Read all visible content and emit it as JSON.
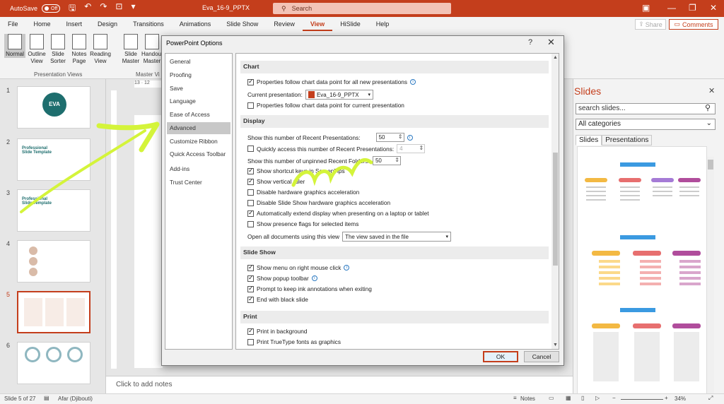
{
  "titlebar": {
    "autosave_label": "AutoSave",
    "autosave_state": "Off",
    "doc_title": "Eva_16-9_PPTX",
    "search_placeholder": "Search"
  },
  "menu": [
    "File",
    "Home",
    "Insert",
    "Design",
    "Transitions",
    "Animations",
    "Slide Show",
    "Review",
    "View",
    "HiSlide",
    "Help"
  ],
  "menu_active": "View",
  "share_label": "Share",
  "comments_label": "Comments",
  "ribbon": {
    "presentation_views": [
      "Normal",
      "Outline View",
      "Slide Sorter",
      "Notes Page",
      "Reading View"
    ],
    "master_views": [
      "Slide Master",
      "Handout Master"
    ],
    "group_presentation_views": "Presentation Views",
    "group_master_views": "Master Vi"
  },
  "ruler_label": "13 · 12",
  "thumbnails": {
    "numbers": [
      "1",
      "2",
      "3",
      "4",
      "5",
      "6"
    ],
    "selected": "5",
    "texts": [
      "EVA",
      "Professional Slide Template",
      "Professional Slide Template"
    ]
  },
  "notes_placeholder": "Click to add notes",
  "status": {
    "slide_info": "Slide 5 of 27",
    "language": "Afar (Djibouti)",
    "notes": "Notes",
    "zoom": "34%"
  },
  "taskpane": {
    "title": "Slides",
    "search_placeholder": "search slides...",
    "category": "All categories",
    "tabs": [
      "Slides",
      "Presentations"
    ]
  },
  "dialog": {
    "title": "PowerPoint Options",
    "nav": [
      "General",
      "Proofing",
      "Save",
      "Language",
      "Ease of Access",
      "Advanced",
      "Customize Ribbon",
      "Quick Access Toolbar",
      "Add-ins",
      "Trust Center"
    ],
    "nav_selected": "Advanced",
    "sections": {
      "chart": "Chart",
      "display": "Display",
      "slideshow": "Slide Show",
      "print": "Print"
    },
    "chart": {
      "follow_new": "Properties follow chart data point for all new presentations",
      "current_presentation_label": "Current presentation:",
      "current_presentation_value": "Eva_16-9_PPTX",
      "follow_current": "Properties follow chart data point for current presentation"
    },
    "display": {
      "recent_label": "Show this number of Recent Presentations:",
      "recent_value": "50",
      "quick_access_label": "Quickly access this number of Recent Presentations:",
      "quick_access_value": "4",
      "unpinned_label": "Show this number of unpinned Recent Folders:",
      "unpinned_value": "50",
      "shortcut_keys": "Show shortcut keys in ScreenTips",
      "vertical_ruler": "Show vertical ruler",
      "disable_hw": "Disable hardware graphics acceleration",
      "disable_ss_hw": "Disable Slide Show hardware graphics acceleration",
      "extend_display": "Automatically extend display when presenting on a laptop or tablet",
      "presence_flags": "Show presence flags for selected items",
      "open_docs_label": "Open all documents using this view",
      "open_docs_value": "The view saved in the file"
    },
    "slideshow": {
      "menu_right": "Show menu on right mouse click",
      "popup_toolbar": "Show popup toolbar",
      "prompt_ink": "Prompt to keep ink annotations when exiting",
      "end_black": "End with black slide"
    },
    "print": {
      "background": "Print in background",
      "truetype": "Print TrueType fonts as graphics"
    },
    "ok": "OK",
    "cancel": "Cancel"
  },
  "colors": {
    "accent": "#c43e1c",
    "annotation": "#d4f43a"
  }
}
